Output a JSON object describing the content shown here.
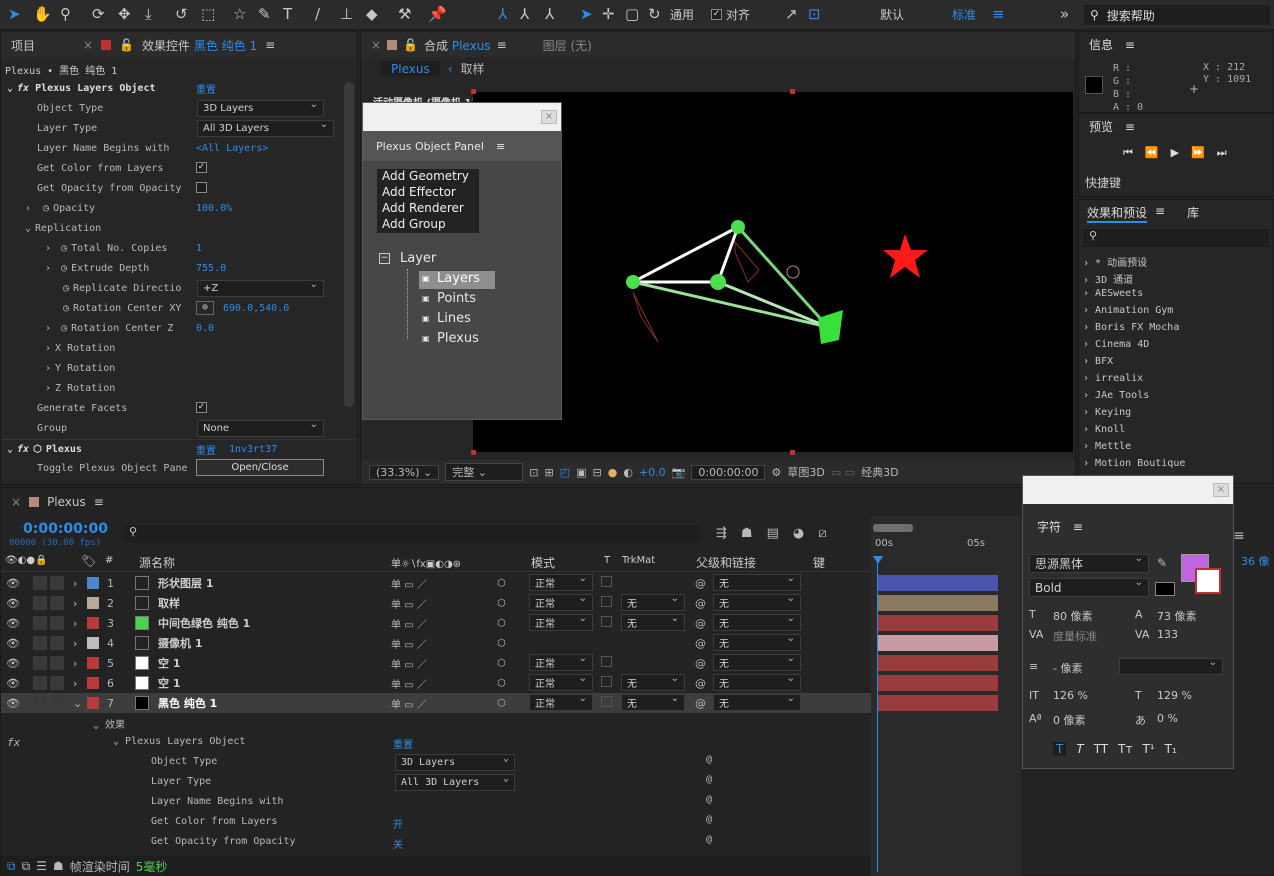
{
  "toolbar": {
    "tools": [
      "selection-tool",
      "hand-tool",
      "zoom-tool",
      "orbit-tool",
      "pan-tool",
      "dolly-tool",
      "rotate-tool",
      "region-tool",
      "pen-tool",
      "mask-tool",
      "type-tool",
      "brush-tool",
      "clone-tool",
      "eraser-tool",
      "roto-tool",
      "pin-tool"
    ],
    "align_label": "通用",
    "snap_label": "对齐",
    "workspace_default": "默认",
    "workspace_standard": "标准",
    "search_placeholder": "搜索帮助"
  },
  "left_panel": {
    "tab_project": "项目",
    "tab_effects_prefix": "效果控件",
    "tab_effects_name": "黑色 纯色 1",
    "breadcrumb": "Plexus • 黑色 纯色 1",
    "effect1_name": "Plexus Layers Object",
    "reset": "重置",
    "props": [
      {
        "label": "Object Type",
        "value": "3D Layers"
      },
      {
        "label": "Layer Type",
        "value": "All 3D Layers"
      },
      {
        "label": "Layer Name Begins with",
        "value": "<All Layers>"
      },
      {
        "label": "Get Color from Layers",
        "value": "✓"
      },
      {
        "label": "Get Opacity from Opacity",
        "value": ""
      },
      {
        "label": "Opacity",
        "value": "100.0%"
      },
      {
        "label": "Replication",
        "value": ""
      },
      {
        "label": "Total No. Copies",
        "value": "1"
      },
      {
        "label": "Extrude Depth",
        "value": "755.0"
      },
      {
        "label": "Replicate Directio",
        "value": "+Z"
      },
      {
        "label": "Rotation Center XY",
        "value": "690.0,540.0"
      },
      {
        "label": "Rotation Center Z",
        "value": "0.0"
      },
      {
        "label": "X Rotation",
        "value": ""
      },
      {
        "label": "Y Rotation",
        "value": ""
      },
      {
        "label": "Z Rotation",
        "value": ""
      },
      {
        "label": "Generate Facets",
        "value": "✓"
      },
      {
        "label": "Group",
        "value": "None"
      }
    ],
    "effect2_name": "Plexus",
    "effect2_reset": "重置",
    "effect2_version": "1nv3rt37",
    "toggle_label": "Toggle Plexus Object Pane",
    "toggle_button": "Open/Close"
  },
  "comp": {
    "tab_prefix": "合成",
    "tab_name": "Plexus",
    "layer_tab": "图层 (无)",
    "breadcrumb_a": "Plexus",
    "breadcrumb_b": "取样",
    "camera_label": "活动摄像机 (摄像机 1)",
    "zoom": "(33.3%)",
    "quality": "完整",
    "exposure": "+0.0",
    "timecode": "0:00:00:00",
    "renderer": "草图3D",
    "view": "经典3D"
  },
  "plexus_panel": {
    "title": "Plexus Object Panel",
    "buttons": [
      "Add Geometry",
      "Add Effector",
      "Add Renderer",
      "Add Group"
    ],
    "tree_root": "Layer",
    "tree_items": [
      "Layers",
      "Points",
      "Lines",
      "Plexus"
    ]
  },
  "info": {
    "title": "信息",
    "r": "R :",
    "g": "G :",
    "b": "B :",
    "a": "A : 0",
    "x": "X : 212",
    "y": "Y : 1091"
  },
  "preview": {
    "title": "预览",
    "shortcut": "快捷键"
  },
  "effects_presets": {
    "title": "效果和预设",
    "lib": "库",
    "items": [
      "* 动画预设",
      "3D 通道",
      "AESweets",
      "Animation Gym",
      "Boris FX Mocha",
      "Cinema 4D",
      "BFX",
      "irrealix",
      "JAe Tools",
      "Keying",
      "Knoll",
      "Mettle",
      "Motion Boutique"
    ]
  },
  "character": {
    "title": "字符",
    "font": "思源黑体",
    "style": "Bold",
    "size": "80 像素",
    "leading": "73 像素",
    "kerning": "度量标准",
    "tracking": "133",
    "stroke": "- 像素",
    "vscale": "126 %",
    "hscale": "129 %",
    "baseline": "0 像素",
    "tsume": "0 %",
    "fill_color": "#c065e0",
    "side_val": "36 像"
  },
  "timeline": {
    "tab": "Plexus",
    "timecode": "0:00:00:00",
    "fps": "00000 (30.00 fps)",
    "search_placeholder": "",
    "cols": {
      "name": "源名称",
      "mode": "模式",
      "t": "T",
      "trkmat": "TrkMat",
      "parent": "父级和链接",
      "key": "键"
    },
    "layers": [
      {
        "num": "1",
        "name": "形状图层 1",
        "color": "#4a86c8",
        "mode": "正常",
        "trk": "",
        "parent": "无",
        "bar": "#4a55b0"
      },
      {
        "num": "2",
        "name": "取样",
        "color": "#b8a99a",
        "mode": "正常",
        "trk": "无",
        "parent": "无",
        "bar": "#8a7a63"
      },
      {
        "num": "3",
        "name": "中间色绿色 纯色 1",
        "color": "#b83a3a",
        "mode": "正常",
        "trk": "无",
        "parent": "无",
        "bar": "#9a3b3b"
      },
      {
        "num": "4",
        "name": "摄像机 1",
        "color": "#bdbdbd",
        "mode": "",
        "trk": "",
        "parent": "无",
        "bar": "#c89aa3"
      },
      {
        "num": "5",
        "name": "空 1",
        "color": "#b83a3a",
        "mode": "正常",
        "trk": "",
        "parent": "无",
        "bar": "#9a3b3b"
      },
      {
        "num": "6",
        "name": "空 1",
        "color": "#b83a3a",
        "mode": "正常",
        "trk": "无",
        "parent": "无",
        "bar": "#9a3b3b"
      },
      {
        "num": "7",
        "name": "黑色 纯色 1",
        "color": "#b83a3a",
        "mode": "正常",
        "trk": "无",
        "parent": "无",
        "bar": "#9a3b3b"
      }
    ],
    "effects_label": "效果",
    "effect_name": "Plexus Layers Object",
    "reset": "重置",
    "sub": [
      {
        "label": "Object Type",
        "value": "3D Layers"
      },
      {
        "label": "Layer Type",
        "value": "All 3D Layers"
      },
      {
        "label": "Layer Name Begins with",
        "value": ""
      },
      {
        "label": "Get Color from Layers",
        "value": "开"
      },
      {
        "label": "Get Opacity from Opacity",
        "value": "关"
      }
    ],
    "render_label": "帧渲染时间",
    "render_value": "5毫秒",
    "ruler_0": "00s",
    "ruler_5": "05s"
  }
}
